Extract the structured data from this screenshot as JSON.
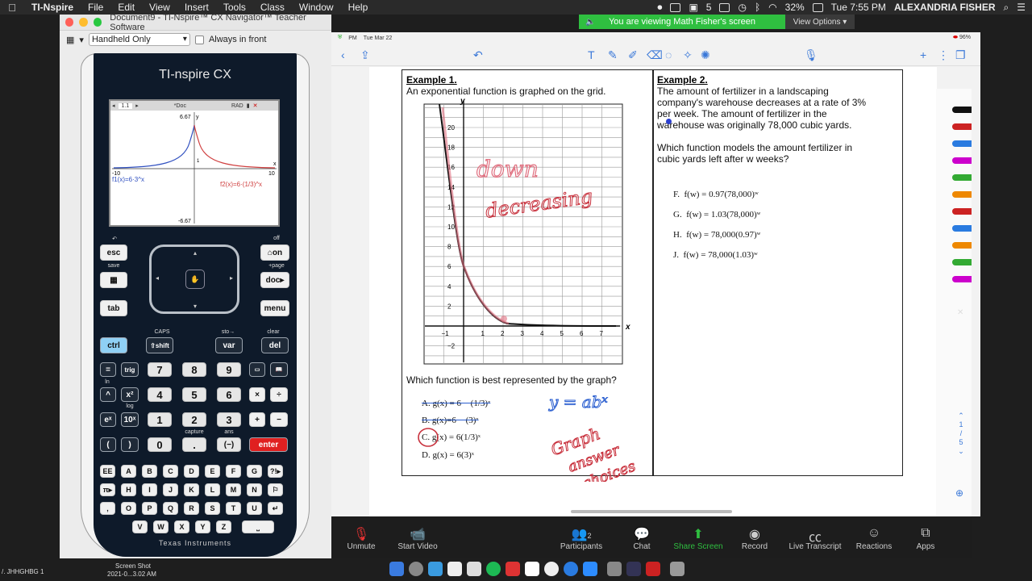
{
  "menubar": {
    "app_name": "TI-Nspire",
    "menus": [
      "File",
      "Edit",
      "View",
      "Insert",
      "Tools",
      "Class",
      "Window",
      "Help"
    ],
    "battery": "32%",
    "clock": "Tue 7:55 PM",
    "user": "ALEXANDRIA FISHER"
  },
  "zoom_banner": {
    "text": "You are viewing Math Fisher's screen",
    "view_options": "View Options"
  },
  "ti_window": {
    "title": "Document9 - TI-Nspire™ CX Navigator™ Teacher Software",
    "view_select": "Handheld Only",
    "always_front_label": "Always in front",
    "brand": "TI-nspire CX",
    "screen": {
      "tab": "1.1",
      "doc": "*Doc",
      "mode": "RAD",
      "y_top": "6.67",
      "y_bottom": "-6.67",
      "x_left": "-10",
      "x_right": "10",
      "f1": "f1(x)=6·3^x",
      "f2": "f2(x)=6·(1/3)^x",
      "y_axis": "y",
      "x_axis": "x",
      "tick_one": "1"
    },
    "keys": {
      "esc": "esc",
      "on": "on",
      "save": "save",
      "doc": "doc",
      "tab": "tab",
      "menu": "menu",
      "ctrl": "ctrl",
      "shift": "shift",
      "var": "var",
      "del": "del",
      "eq": "=",
      "trig": "trig",
      "hat": "^",
      "x2": "x²",
      "ex": "eˣ",
      "tenx": "10ˣ",
      "lparen": "(",
      "rparen": ")",
      "n7": "7",
      "n8": "8",
      "n9": "9",
      "n4": "4",
      "n5": "5",
      "n6": "6",
      "n1": "1",
      "n2": "2",
      "n3": "3",
      "n0": "0",
      "dot": ".",
      "neg": "(−)",
      "enter": "enter",
      "times": "×",
      "divide": "÷",
      "plus": "+",
      "minus": "−",
      "off": "off",
      "plus_page": "+page",
      "caps": "CAPS",
      "sto": "sto→",
      "clear": "clear",
      "capture": "capture",
      "ans": "ans",
      "log": "log",
      "ln": "ln"
    },
    "letters": [
      "EE",
      "A",
      "B",
      "C",
      "D",
      "E",
      "F",
      "G",
      "?!▸",
      "π▸",
      "H",
      "I",
      "J",
      "K",
      "L",
      "M",
      "N",
      "⚐",
      "‚",
      "O",
      "P",
      "Q",
      "R",
      "S",
      "T",
      "U",
      "↵",
      "V",
      "W",
      "X",
      "Y",
      "Z",
      "⎵"
    ],
    "footer": "Texas Instruments"
  },
  "dock_left": {
    "label1": "/. JHHGHBG 1",
    "label2": "Screen Shot",
    "label3": "2021-0...3.02 AM"
  },
  "goodnotes": {
    "status_time": "PM",
    "status_date": "Tue Mar 22",
    "battery": "96%"
  },
  "worksheet": {
    "ex1_title": "Example 1.",
    "ex1_text": "An exponential function is graphed on the grid.",
    "ex1_question": "Which function is best represented by the graph?",
    "ex1_choices": [
      {
        "label": "A.",
        "expr": "g(x) = 6 − (1/3)ˣ"
      },
      {
        "label": "B.",
        "expr": "g(x)=6 − (3)ˣ"
      },
      {
        "label": "C.",
        "expr": "g(x) = 6(1/3)ˣ"
      },
      {
        "label": "D.",
        "expr": "g(x) = 6(3)ˣ"
      }
    ],
    "graph": {
      "y_label": "y",
      "x_label": "x",
      "y_ticks": [
        "20",
        "18",
        "16",
        "14",
        "12",
        "10",
        "8",
        "6",
        "4",
        "2",
        "−2"
      ],
      "x_ticks": [
        "−1",
        "1",
        "2",
        "3",
        "4",
        "5",
        "6",
        "7"
      ]
    },
    "ex2_title": "Example 2.",
    "ex2_text": [
      "The amount of fertilizer in a landscaping",
      "company's warehouse decreases at a rate of 3%",
      "per week. The amount of fertilizer in the",
      "warehouse was originally 78,000 cubic yards."
    ],
    "ex2_question": [
      "Which function models the amount fertilizer in",
      "cubic yards left after w weeks?"
    ],
    "ex2_choices": [
      {
        "label": "F.",
        "expr": "f(w) = 0.97(78,000)ʷ"
      },
      {
        "label": "G.",
        "expr": "f(w) = 1.03(78,000)ʷ"
      },
      {
        "label": "H.",
        "expr": "f(w) = 78,000(0.97)ʷ"
      },
      {
        "label": "J.",
        "expr": "f(w) = 78,000(1.03)ʷ"
      }
    ],
    "ink": {
      "down": "down",
      "decreasing": "decreasing",
      "form": "y = abˣ",
      "graph_answer": [
        "Graph",
        "answer",
        "choices"
      ]
    }
  },
  "page_indicator": [
    "1",
    "/",
    "5"
  ],
  "zoom_toolbar": {
    "unmute": "Unmute",
    "video": "Start Video",
    "participants": "Participants",
    "participants_count": "2",
    "chat": "Chat",
    "share": "Share Screen",
    "record": "Record",
    "transcript": "Live Transcript",
    "reactions": "Reactions",
    "apps": "Apps"
  }
}
